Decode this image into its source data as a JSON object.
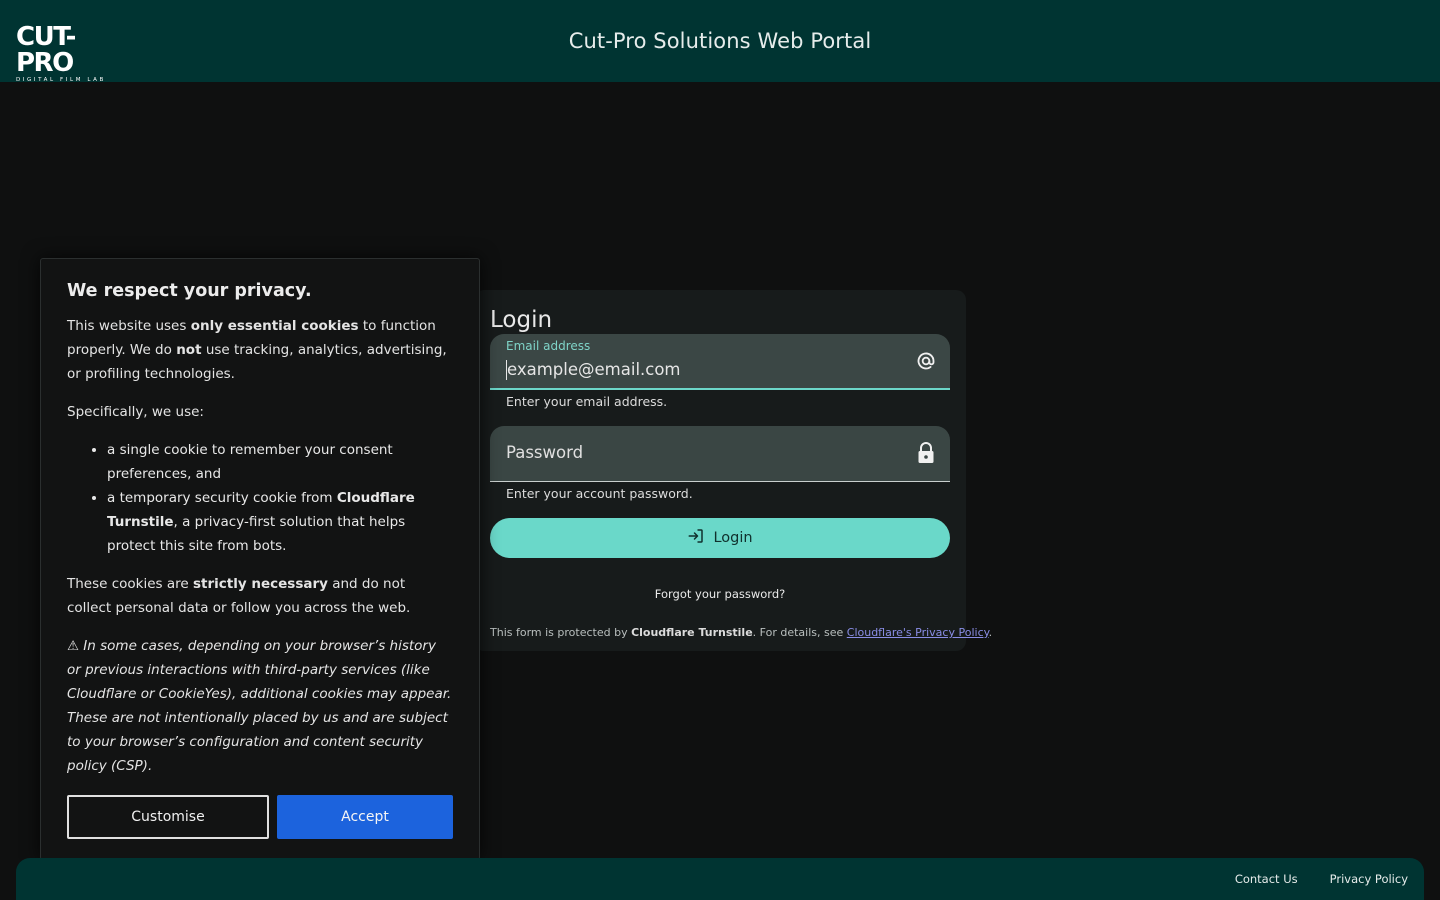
{
  "header": {
    "logo_main": "CUT-PRO",
    "logo_sub": "DIGITAL FILM LAB",
    "title": "Cut-Pro Solutions Web Portal"
  },
  "login": {
    "title": "Login",
    "email": {
      "label": "Email address",
      "value": "example@email.com",
      "helper": "Enter your email address.",
      "icon": "at-sign-icon"
    },
    "password": {
      "placeholder": "Password",
      "helper": "Enter your account password.",
      "icon": "lock-icon"
    },
    "button_label": "Login",
    "button_icon": "login-icon",
    "forgot_label": "Forgot your password?",
    "protected_prefix": "This form is protected by ",
    "protected_brand": "Cloudflare Turnstile",
    "protected_mid": ". For details, see ",
    "protected_link": "Cloudflare's Privacy Policy",
    "protected_suffix": "."
  },
  "cookie": {
    "title": "We respect your privacy.",
    "p1_a": "This website uses ",
    "p1_b": "only essential cookies",
    "p1_c": " to function properly. We do ",
    "p1_d": "not",
    "p1_e": " use tracking, analytics, advertising, or profiling technologies.",
    "p2": "Specifically, we use:",
    "li1": "a single cookie to remember your consent preferences, and",
    "li2_a": "a temporary security cookie from ",
    "li2_b": "Cloudflare Turnstile",
    "li2_c": ", a privacy-first solution that helps protect this site from bots.",
    "p3_a": "These cookies are ",
    "p3_b": "strictly necessary",
    "p3_c": " and do not collect personal data or follow you across the web.",
    "warning": "⚠ In some cases, depending on your browser’s history or previous interactions with third-party services (like Cloudflare or CookieYes), additional cookies may appear. These are not intentionally placed by us and are subject to your browser’s configuration and content security policy (CSP).",
    "customise_label": "Customise",
    "accept_label": "Accept"
  },
  "footer": {
    "contact_label": "Contact Us",
    "privacy_label": "Privacy Policy"
  },
  "colors": {
    "header_bg": "#003432",
    "accent": "#6ad8c9",
    "accept_bg": "#1c63dd",
    "page_bg": "#0f1010"
  }
}
